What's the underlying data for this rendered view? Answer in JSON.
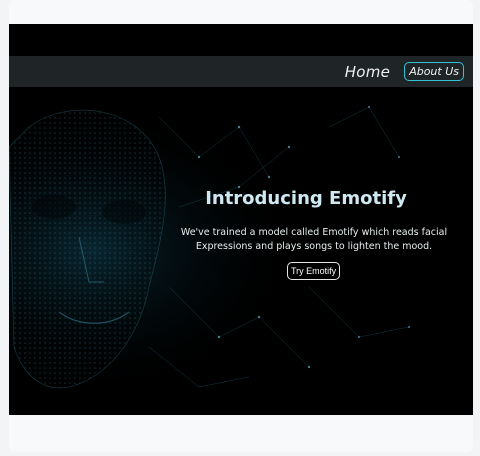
{
  "nav": {
    "home_label": "Home",
    "about_label": "About Us"
  },
  "hero": {
    "title": "Introducing Emotify",
    "description": "We've trained a model called Emotify which reads facial Expressions and plays songs to lighten the mood.",
    "cta_label": "Try Emotify"
  },
  "colors": {
    "accent": "#34c1d6",
    "navbar": "#1f2426",
    "background": "#000000"
  },
  "icons": {
    "hero_image": "wireframe-face-icon"
  }
}
